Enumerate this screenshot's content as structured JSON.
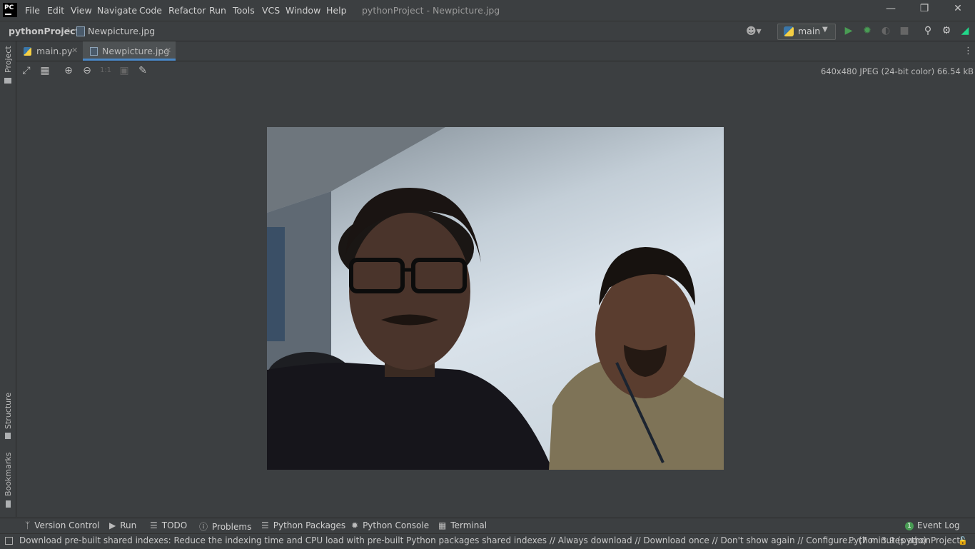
{
  "menu": {
    "logo": "PC",
    "items": [
      "File",
      "Edit",
      "View",
      "Navigate",
      "Code",
      "Refactor",
      "Run",
      "Tools",
      "VCS",
      "Window",
      "Help"
    ],
    "window_title": "pythonProject - Newpicture.jpg"
  },
  "navbar": {
    "project": "pythonProject",
    "file": "Newpicture.jpg",
    "run_config": "main"
  },
  "sidebar": {
    "project": "Project",
    "structure": "Structure",
    "bookmarks": "Bookmarks"
  },
  "tabs": [
    {
      "label": "main.py",
      "active": false
    },
    {
      "label": "Newpicture.jpg",
      "active": true
    }
  ],
  "image_toolbar": {
    "actual_size": "1:1",
    "image_info": "640x480 JPEG (24-bit color) 66.54 kB"
  },
  "tool_windows": [
    "Version Control",
    "Run",
    "TODO",
    "Problems",
    "Python Packages",
    "Python Console",
    "Terminal"
  ],
  "event_log": {
    "count": "1",
    "label": "Event Log"
  },
  "status": {
    "message": "Download pre-built shared indexes: Reduce the indexing time and CPU load with pre-built Python packages shared indexes // Always download // Download once // Don't show again // Configure... (7 minutes ago)",
    "interpreter": "Python 3.9 (pythonProject)"
  },
  "colors": {
    "background": "#3c3f41",
    "accent": "#4a88c7",
    "run_green": "#499c54"
  }
}
